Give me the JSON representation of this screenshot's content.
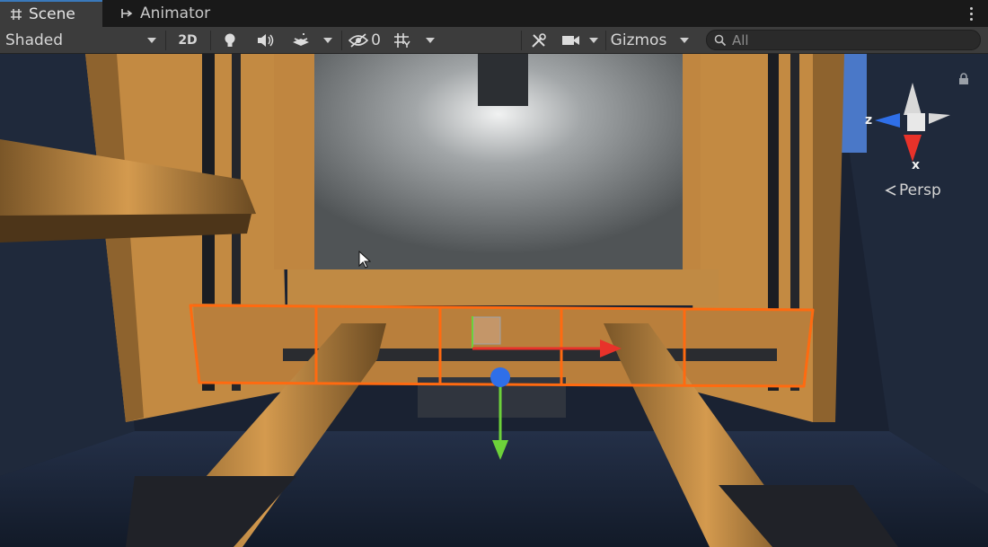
{
  "tabs": [
    {
      "label": "Scene",
      "icon": "grid-hash-icon",
      "active": true
    },
    {
      "label": "Animator",
      "icon": "animator-icon",
      "active": false
    }
  ],
  "toolbar": {
    "shading_mode": "Shaded",
    "mode_2d": "2D",
    "hidden_count": "0",
    "gizmos_label": "Gizmos",
    "search_placeholder": "All"
  },
  "viewport": {
    "projection_label": "Persp",
    "axes": {
      "z": "z",
      "x": "x"
    }
  },
  "colors": {
    "selection_outline": "#ff6a10",
    "axis_x": "#e8322a",
    "axis_y": "#6dd13a",
    "axis_z": "#2f6fe8",
    "accent_tab": "#3a79bb"
  }
}
